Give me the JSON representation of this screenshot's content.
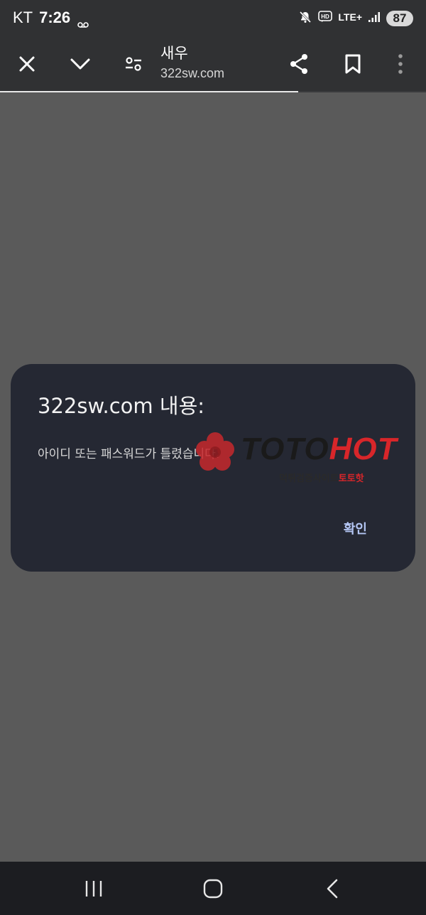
{
  "status_bar": {
    "carrier": "KT",
    "time": "7:26",
    "network": "LTE+",
    "battery": "87",
    "icons": [
      "voicemail-icon",
      "mute-icon",
      "hd-icon",
      "lte-icon",
      "signal-icon",
      "battery-icon"
    ]
  },
  "toolbar": {
    "page_title": "새우",
    "page_url": "322sw.com",
    "load_progress_percent": 70,
    "icons": [
      "close-icon",
      "chevron-down-icon",
      "page-settings-icon",
      "share-icon",
      "bookmark-icon",
      "more-vert-icon"
    ]
  },
  "dialog": {
    "title": "322sw.com 내용:",
    "message": "아이디 또는 패스워드가 틀렸습니다.",
    "ok_label": "확인"
  },
  "watermark": {
    "brand_part1": "TOTO",
    "brand_part2": "HOT",
    "tagline_part1": "먹튀검증사이트",
    "tagline_part2": "토토핫"
  },
  "nav_bar": {
    "icons": [
      "recent-apps-icon",
      "home-icon",
      "back-icon"
    ]
  },
  "colors": {
    "status_bg": "#303133",
    "page_bg": "#5a5a5a",
    "dialog_bg": "#252833",
    "dialog_button": "#b4c6f4",
    "watermark_red": "#d8262a",
    "nav_bg": "#1c1d21"
  }
}
